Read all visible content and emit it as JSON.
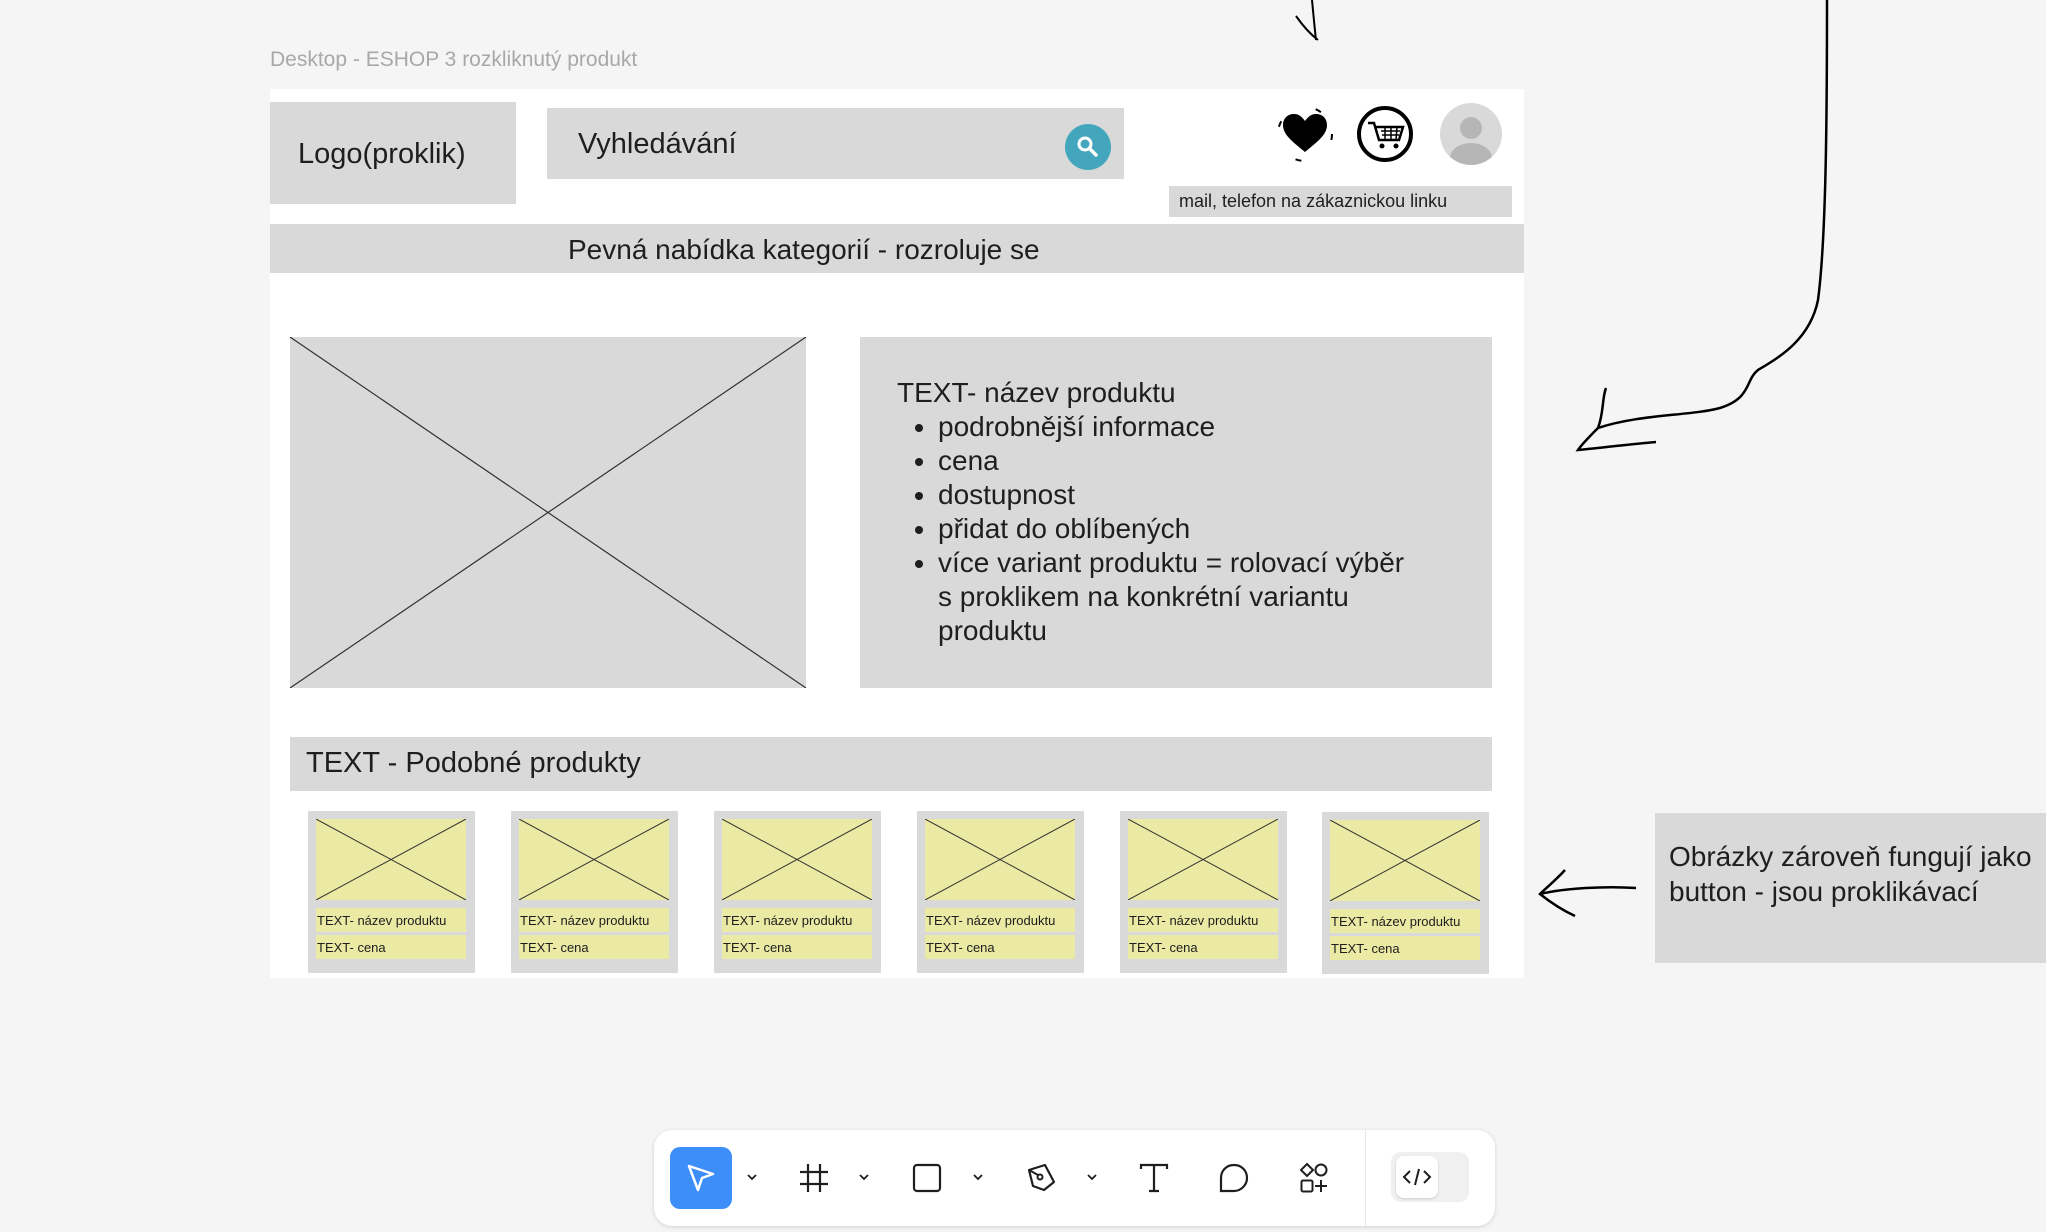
{
  "frame": {
    "label": "Desktop - ESHOP 3 rozkliknutý produkt"
  },
  "header": {
    "logo": "Logo(proklik)",
    "search_placeholder": "Vyhledávání",
    "contact": "mail, telefon na zákaznickou linku"
  },
  "categories": {
    "label": "Pevná nabídka kategorií - rozroluje se"
  },
  "product": {
    "title": "TEXT- název produktu",
    "bullets": [
      "podrobnější informace",
      "cena",
      "dostupnost",
      "přidat do oblíbených",
      "více variant produktu = rolovací výběr s proklikem na konkrétní variantu produktu"
    ]
  },
  "similar": {
    "heading": "TEXT - Podobné produkty",
    "cards": [
      {
        "name": "TEXT- název produktu",
        "price": "TEXT- cena"
      },
      {
        "name": "TEXT- název produktu",
        "price": "TEXT- cena"
      },
      {
        "name": "TEXT- název produktu",
        "price": "TEXT- cena"
      },
      {
        "name": "TEXT- název produktu",
        "price": "TEXT- cena"
      },
      {
        "name": "TEXT- název produktu",
        "price": "TEXT- cena"
      },
      {
        "name": "TEXT- název produktu",
        "price": "TEXT- cena"
      }
    ]
  },
  "note": {
    "text": "Obrázky zároveň fungují jako\nbutton - jsou proklikávací"
  },
  "icons": {
    "search": "search-icon",
    "favorite": "heart-icon",
    "cart": "cart-icon",
    "user": "avatar-icon",
    "tools": [
      "move-tool-icon",
      "frame-tool-icon",
      "rectangle-tool-icon",
      "pen-tool-icon",
      "text-tool-icon",
      "comment-tool-icon",
      "components-icon",
      "dev-mode-icon"
    ]
  },
  "colors": {
    "accent": "#44a6bd",
    "active_tool": "#3d8ef8",
    "placeholder": "#eaeaa4",
    "wire_gray": "#d9d9d9"
  }
}
